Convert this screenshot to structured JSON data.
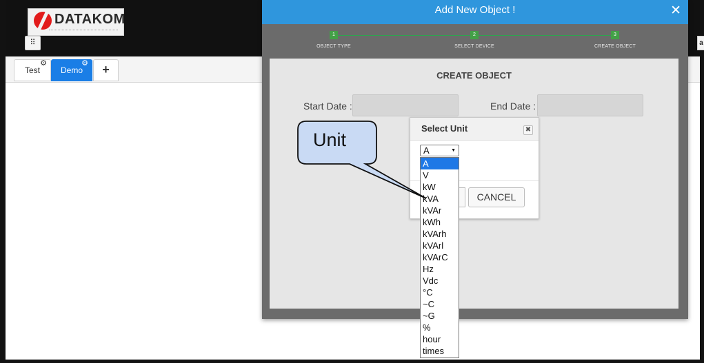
{
  "app": {
    "logo_text": "DATAKOM",
    "grid_icon": "⠿",
    "right_stub": "a"
  },
  "tabs": [
    {
      "label": "Test",
      "active": false
    },
    {
      "label": "Demo",
      "active": true
    },
    {
      "label": "+",
      "active": false
    }
  ],
  "modal": {
    "title": "Add New Object !",
    "close": "✕",
    "steps": [
      {
        "number": "1",
        "label": "OBJECT TYPE"
      },
      {
        "number": "2",
        "label": "SELECT DEVICE"
      },
      {
        "number": "3",
        "label": "CREATE OBJECT"
      }
    ],
    "body_title": "CREATE OBJECT",
    "start_date_label": "Start Date :",
    "end_date_label": "End Date :",
    "start_date_value": "",
    "end_date_value": ""
  },
  "unit_popup": {
    "title": "Select Unit",
    "close": "✖",
    "selected_value": "A",
    "options": [
      "A",
      "V",
      "kW",
      "kVA",
      "kVAr",
      "kWh",
      "kVArh",
      "kVArl",
      "kVArC",
      "Hz",
      "Vdc",
      "°C",
      "~C",
      "~G",
      "%",
      "hour",
      "times"
    ],
    "cancel_label": "CANCEL"
  },
  "callout": {
    "text": "Unit"
  },
  "colors": {
    "accent": "#2f96dd",
    "tab_active": "#1a7ee6",
    "step_green": "#43a047",
    "selected_option": "#1e78e6"
  }
}
